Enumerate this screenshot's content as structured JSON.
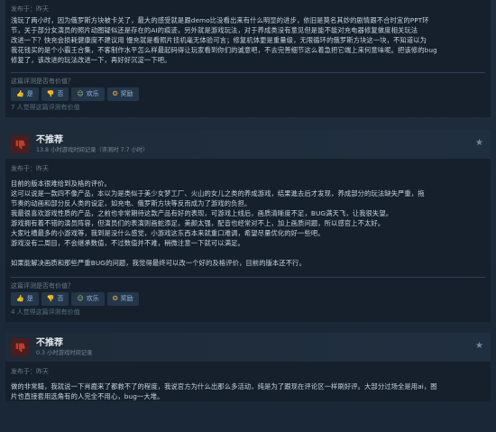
{
  "reviews": [
    {
      "posted": "发布于：昨天",
      "body": [
        "浅玩了两小时，因为俄罗斯方块被卡关了，最大的感受就是跟demo比没看出来有什么明显的进步，依旧是莫名其妙的剧情跟不合时宜的PPT环",
        "节，关于部分女演员的照片动图疑似还是存在的AI的痕迹，另外就是游戏玩法，对于养成类没有意见但是能不能对充电器修复做度相关玩法",
        "改进一下？快充会损耗健康度不建议用 慢充就是看照片挂机毫无体验可言；修复机体更是重量级，无限循环的俄罗斯方块这一块，不知道以为",
        "我花钱买的是个小霸王合集，不客制作水平怎么样最起码得让玩家看到你们的诚意吧，不去完善细节这么着急把它端上来何意味呢。把该修的bug",
        "修复了，该改进的玩法改进一下，再好好沉淀一下吧。"
      ],
      "helpful_question": "这篇评测是否有价值？",
      "buttons": {
        "yes": "是",
        "no": "否",
        "funny": "欢乐",
        "award": "奖励"
      },
      "helpful_count": "7 人觉得这篇评测有价值"
    },
    {
      "verdict": "不推荐",
      "hours": "13.8 小时游戏时间记录（评测时 7.7 小时）",
      "posted": "发布于：昨天",
      "body": [
        "目前的版本很难给到及格的评价。",
        "这可以说是一款四不像产品，本以为是类似于美少女梦工厂、火山的女儿之类的养成游戏，结果進去后才发现，养成部分的玩法缺失严重，拖",
        "节奏的动画和部分反人类的设定，如充电、俄罗斯方块等反而成为了游戏的负担。",
        "我最很喜欢游戏性质的产品，之前也非常期待这款产品有好的表现，可游戏上线后，画质清晰度不足，BUG满天飞，让我很失望。",
        "游戏拥有着不错的演员阵容，但演员们的表演则画蛇添足，美颜太强，配音也经常对不上，加上画质问题，所以感官上不太好。",
        "大家吐槽最多的小游戏等，我到是没什么感觉，小游戏这东西本来就重口难调，希望尽量优化的好一些吧。",
        "游戏没有二周目，不会继承数值，不过数值并不难，稍微注意一下就可以满足。",
        "",
        "如果能解决画质和那些严重BUG的问题，我觉得最终可以改一个好的及格评价，目前的版本还不行。"
      ],
      "helpful_question": "这篇评测是否有价值？",
      "buttons": {
        "yes": "是",
        "no": "否",
        "funny": "欢乐",
        "award": "奖励"
      },
      "helpful_count": "4 人觉得这篇评测有价值"
    },
    {
      "verdict": "不推荐",
      "hours": "0.3 小时游戏时间记录",
      "posted": "发布于：昨天",
      "body": [
        "做的非常糙，我就说一下肖鹿来了都救不了的程度，我说官方为什么出那么多活动，纯是为了跟现在评论区一样刷好评。大部分过场全是用ai，图",
        "片也直接套用选角有的人完全不用心，bug一大堆。"
      ]
    }
  ],
  "colors": {
    "background": "#1b2838",
    "card": "#16202d",
    "not_recommended_thumb": "#c23c2a",
    "link_blue": "#66c0f4"
  },
  "icons": {
    "thumbs_down": "thumbs-down-icon",
    "thumbs_up": "thumbs-up-icon",
    "favorite": "star-icon"
  }
}
